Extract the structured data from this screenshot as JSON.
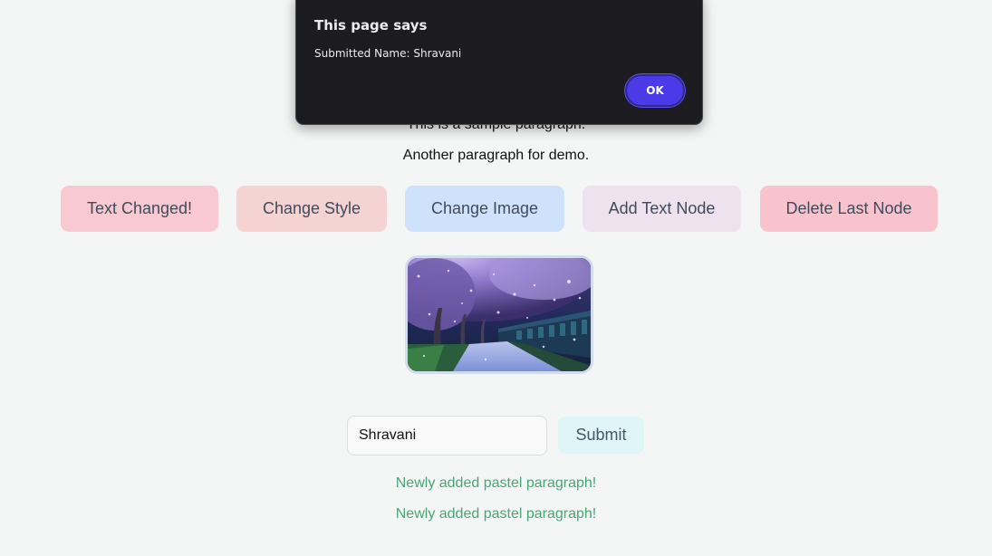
{
  "paragraphs": {
    "first": "This is a sample paragraph.",
    "second": "Another paragraph for demo."
  },
  "buttons": {
    "text_changed": "Text Changed!",
    "change_style": "Change Style",
    "change_image": "Change Image",
    "add_text_node": "Add Text Node",
    "delete_last_node": "Delete Last Node"
  },
  "form": {
    "name_value": "Shravani",
    "submit_label": "Submit"
  },
  "added_paragraphs": [
    "Newly added pastel paragraph!",
    "Newly added pastel paragraph!"
  ],
  "dialog": {
    "title": "This page says",
    "message": "Submitted Name: Shravani",
    "ok_label": "OK"
  },
  "colors": {
    "page_background": "#f4f6f5",
    "added_text": "#45a773",
    "dialog_background": "#1c1b20",
    "ok_button": "#4a3ae8"
  }
}
